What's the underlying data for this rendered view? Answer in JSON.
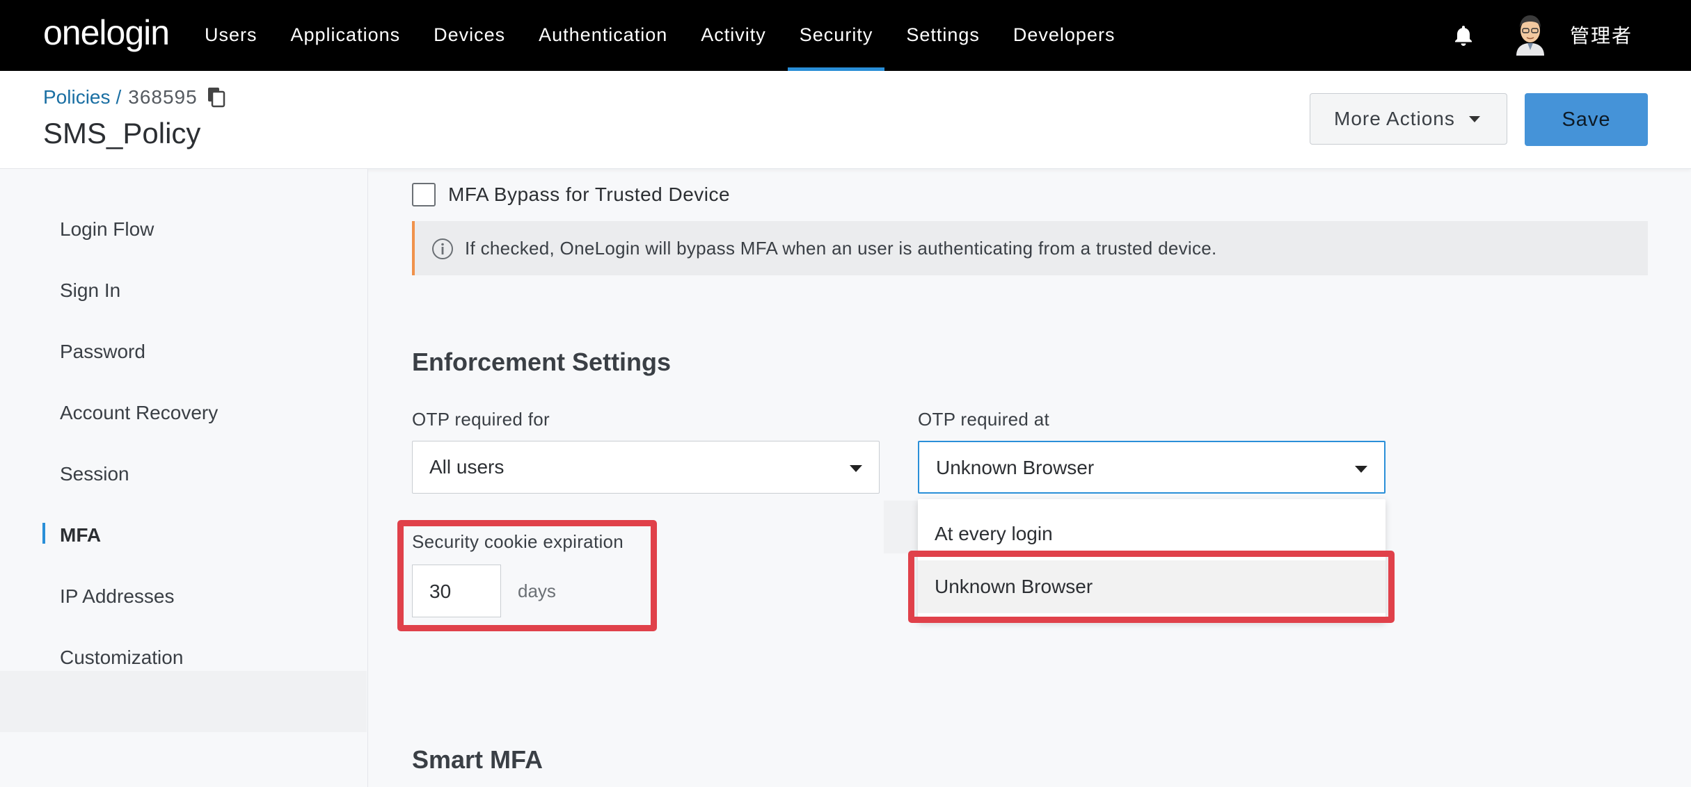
{
  "nav": {
    "logo": "onelogin",
    "items": [
      "Users",
      "Applications",
      "Devices",
      "Authentication",
      "Activity",
      "Security",
      "Settings",
      "Developers"
    ],
    "active": "Security",
    "user_name": "管理者"
  },
  "header": {
    "breadcrumb_link": "Policies",
    "breadcrumb_sep": "/",
    "policy_id": "368595",
    "title": "SMS_Policy",
    "more_actions_label": "More Actions",
    "save_label": "Save"
  },
  "sidebar": {
    "items": [
      "Login Flow",
      "Sign In",
      "Password",
      "Account Recovery",
      "Session",
      "MFA",
      "IP Addresses",
      "Customization"
    ],
    "active": "MFA"
  },
  "main": {
    "bypass_checkbox": {
      "label": "MFA Bypass for Trusted Device",
      "checked": false
    },
    "info_text": "If checked, OneLogin will bypass MFA when an user is authenticating from a trusted device.",
    "enforcement_title": "Enforcement Settings",
    "otp_required_for": {
      "label": "OTP required for",
      "value": "All users"
    },
    "otp_required_at": {
      "label": "OTP required at",
      "value": "Unknown Browser",
      "options": [
        "At every login",
        "Unknown Browser"
      ],
      "selected": "Unknown Browser"
    },
    "cookie_expiration": {
      "label": "Security cookie expiration",
      "value": "30",
      "unit": "days"
    },
    "smart_mfa_title": "Smart MFA"
  },
  "colors": {
    "nav_bg": "#000000",
    "accent": "#2a8fd8",
    "save_button": "#4593d8",
    "info_border": "#f0924b",
    "highlight": "#e0414a"
  }
}
